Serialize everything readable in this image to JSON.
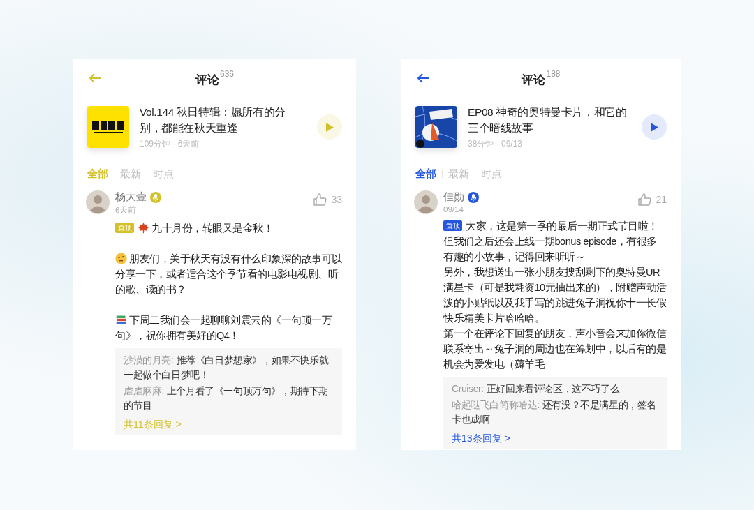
{
  "screens": [
    {
      "color": "#d4c12a",
      "title": "评论",
      "count": "636",
      "episode": {
        "title": "Vol.144 秋日特辑：愿所有的分别，都能在秋天重逢",
        "meta": "109分钟 · 6天前"
      },
      "tabs": [
        {
          "label": "全部",
          "selected": true
        },
        {
          "label": "最新",
          "selected": false
        },
        {
          "label": "时点",
          "selected": false
        }
      ],
      "comment": {
        "author": "杨大壹",
        "host": true,
        "time": "6天前",
        "likes": "33",
        "pinned": true,
        "pin_label": "置顶",
        "spaced": true,
        "paragraphs": [
          {
            "kind": "leaf",
            "text": "九十月份，转眼又是金秋！"
          },
          {
            "kind": "face",
            "text": "朋友们，关于秋天有没有什么印象深的故事可以分享一下，或者适合这个季节看的电影电视剧、听的歌、读的书？"
          },
          {
            "kind": "books",
            "text": "下周二我们会一起聊聊刘震云的《一句顶一万句》，祝你拥有美好的Q4！"
          }
        ],
        "replies": [
          {
            "author": "沙漠的月亮:",
            "text": "推荐《白日梦想家》，如果不快乐就一起做个白日梦吧！"
          },
          {
            "author": "虐虐麻麻:",
            "text": "上个月看了《一句顶万句》，期待下期的节目"
          }
        ],
        "more": "共11条回复 >"
      }
    },
    {
      "color": "#2456e0",
      "title": "评论",
      "count": "188",
      "episode": {
        "title": "EP08 神奇的奥特曼卡片，和它的三个暗线故事",
        "meta": "38分钟 · 09/13"
      },
      "tabs": [
        {
          "label": "全部",
          "selected": true
        },
        {
          "label": "最新",
          "selected": false
        },
        {
          "label": "时点",
          "selected": false
        }
      ],
      "comment": {
        "author": "佳勋",
        "host": true,
        "time": "09/14",
        "likes": "21",
        "pinned": true,
        "pin_label": "置顶",
        "spaced": false,
        "paragraphs": [
          {
            "kind": "plain",
            "text": "大家，这是第一季的最后一期正式节目啦！但我们之后还会上线一期bonus episode，有很多有趣的小故事，记得回来听听～"
          },
          {
            "kind": "plain",
            "text": "另外，我想送出一张小朋友搜刮剩下的奥特曼UR满星卡（可是我耗资10元抽出来的），附赠声动活泼的小贴纸以及我手写的跳进兔子洞祝你十一长假快乐精美卡片哈哈哈。"
          },
          {
            "kind": "plain",
            "text": "第一个在评论下回复的朋友，声小音会来加你微信联系寄出～兔子洞的周边也在筹划中，以后有的是机会为爱发电（薅羊毛"
          }
        ],
        "replies": [
          {
            "author": "Cruiser:",
            "text": "正好回来看评论区，这不巧了么"
          },
          {
            "author": "哈起哒飞白简称哈达:",
            "text": "还有没？不是满星的，签名卡也成啊"
          }
        ],
        "more": "共13条回复 >"
      }
    }
  ]
}
